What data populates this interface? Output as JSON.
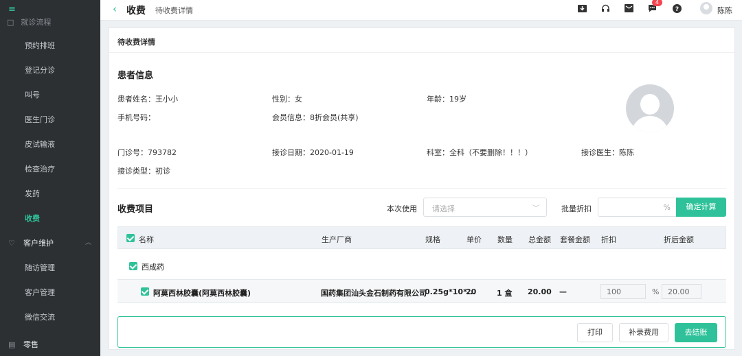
{
  "sidebar": {
    "toggle_icon": "menu-icon",
    "partial_top": "就诊流程",
    "items": [
      {
        "label": "预约排班"
      },
      {
        "label": "登记分诊"
      },
      {
        "label": "叫号"
      },
      {
        "label": "医生门诊"
      },
      {
        "label": "皮试输液"
      },
      {
        "label": "检查治疗"
      },
      {
        "label": "发药"
      },
      {
        "label": "收费",
        "active": true
      }
    ],
    "group_customer": "客户维护",
    "customer_items": [
      {
        "label": "随访管理"
      },
      {
        "label": "客户管理"
      },
      {
        "label": "微信交流"
      }
    ],
    "group_retail": "零售"
  },
  "header": {
    "title": "收费",
    "crumb": "待收费详情",
    "icons": [
      "download-icon",
      "headset-icon",
      "mail-icon",
      "chat-icon",
      "help-icon"
    ],
    "chat_badge": "4",
    "username": "陈陈"
  },
  "card": {
    "title": "待收费详情",
    "patient_section": "患者信息",
    "patient": {
      "name": "患者姓名：王小小",
      "gender": "性别：女",
      "age": "年龄：19岁",
      "phone": "手机号码：",
      "member": "会员信息：8折会员(共享)",
      "clinic_no": "门诊号：793782",
      "visit_date": "接诊日期：2020-01-19",
      "department": "科室：全科（不要删除！！！）",
      "doctor": "接诊医生：陈陈",
      "visit_type": "接诊类型：初诊"
    },
    "charges_section": "收费项目",
    "use_label": "本次使用",
    "select_placeholder": "请选择",
    "batch_discount_label": "批量折扣",
    "percent": "%",
    "calc_button": "确定计算"
  },
  "table": {
    "headers": {
      "name": "名称",
      "manufacturer": "生产厂商",
      "spec": "规格",
      "unit_price": "单价",
      "quantity": "数量",
      "total": "总金额",
      "package_amount": "套餐金额",
      "discount": "折扣",
      "after_discount": "折后金额"
    },
    "group": "西成药",
    "rows": [
      {
        "name": "阿莫西林胶囊(阿莫西林胶囊)",
        "manufacturer": "国药集团汕头金石制药有限公司",
        "spec": "0.25g*10*...",
        "unit_price": "20",
        "quantity": "1 盒",
        "total": "20.00",
        "package_amount": "—",
        "discount": "100",
        "percent": "%",
        "after_discount": "20.00"
      }
    ]
  },
  "footer": {
    "print": "打印",
    "add_fee": "补录费用",
    "checkout": "去结账"
  },
  "colors": {
    "accent": "#2fc29a",
    "sidebar_bg": "#2c3033",
    "badge": "#f5454f"
  }
}
